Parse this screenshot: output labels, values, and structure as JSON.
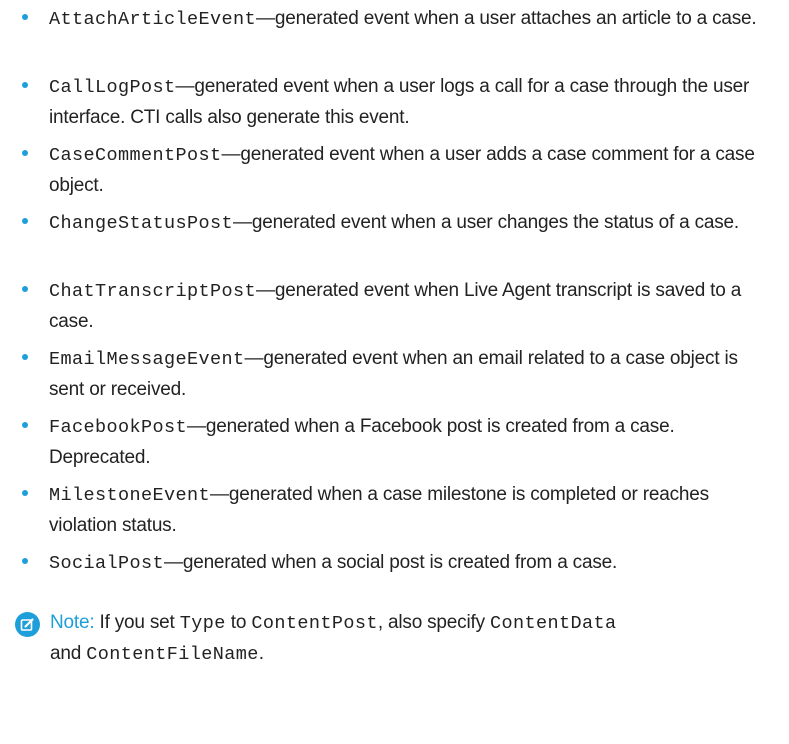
{
  "list": {
    "items": [
      {
        "code": "AttachArticleEvent",
        "text": "—generated event when a user attaches an article to a case."
      },
      {
        "code": "CallLogPost",
        "text": "—generated event when a user logs a call for a case through the user interface. CTI calls also generate this event."
      },
      {
        "code": "CaseCommentPost",
        "text": "—generated event when a user adds a case comment for a case object."
      },
      {
        "code": "ChangeStatusPost",
        "text": "—generated event when a user changes the status of a case."
      },
      {
        "code": "ChatTranscriptPost",
        "text": "—generated event when Live Agent transcript is saved to a case."
      },
      {
        "code": "EmailMessageEvent",
        "text": "—generated event when an email related to a case object is sent or received."
      },
      {
        "code": "FacebookPost",
        "text": "—generated when a Facebook post is created from a case. Deprecated."
      },
      {
        "code": "MilestoneEvent",
        "text": "—generated when a case milestone is completed or reaches violation status."
      },
      {
        "code": "SocialPost",
        "text": "—generated when a social post is created from a case."
      }
    ]
  },
  "note": {
    "label": "Note:",
    "text_1": " If you set ",
    "code_1": "Type",
    "text_2": " to ",
    "code_2": "ContentPost",
    "text_3": ", also specify ",
    "code_3": "ContentData",
    "text_4": " and ",
    "code_4": "ContentFileName",
    "text_5": ".",
    "icon": "edit-note-icon"
  },
  "colors": {
    "accent": "#1e9fd9",
    "text": "#222222"
  }
}
